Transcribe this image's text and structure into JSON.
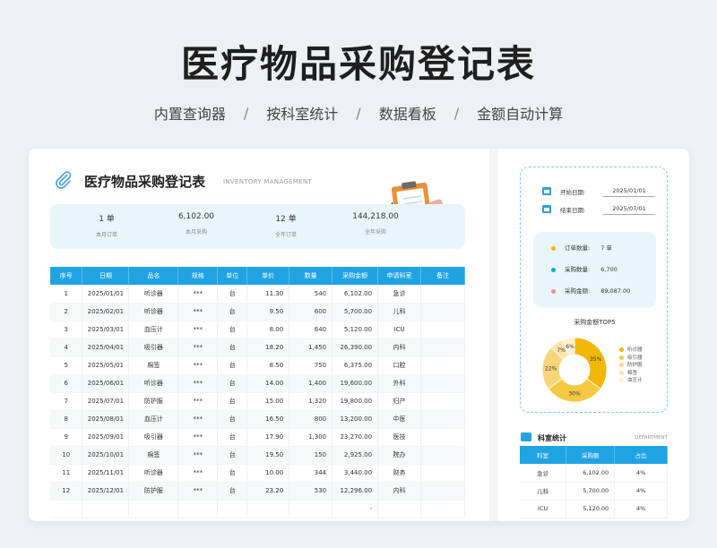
{
  "hero": {
    "title": "医疗物品采购登记表",
    "features": [
      "内置查询器",
      "按科室统计",
      "数据看板",
      "金额自动计算"
    ],
    "separator": "/"
  },
  "sheet": {
    "title": "医疗物品采购登记表",
    "subtitle": "INVENTORY MANAGEMENT"
  },
  "stats": [
    {
      "value": "1 单",
      "label": "本月订单"
    },
    {
      "value": "6,102.00",
      "label": "本月采购"
    },
    {
      "value": "12 单",
      "label": "全年订单"
    },
    {
      "value": "144,218.00",
      "label": "全年采购"
    }
  ],
  "table": {
    "headers": [
      "序号",
      "日期",
      "品名",
      "规格",
      "单位",
      "单价",
      "数量",
      "采购金额",
      "申请科室",
      "备注"
    ],
    "rows": [
      [
        "1",
        "2025/01/01",
        "听诊器",
        "***",
        "台",
        "11.30",
        "540",
        "6,102.00",
        "急诊",
        ""
      ],
      [
        "2",
        "2025/02/01",
        "听诊器",
        "***",
        "台",
        "9.50",
        "600",
        "5,700.00",
        "儿科",
        ""
      ],
      [
        "3",
        "2025/03/01",
        "血压计",
        "***",
        "台",
        "8.00",
        "640",
        "5,120.00",
        "ICU",
        ""
      ],
      [
        "4",
        "2025/04/01",
        "吸引器",
        "***",
        "台",
        "18.20",
        "1,450",
        "26,390.00",
        "内科",
        ""
      ],
      [
        "5",
        "2025/05/01",
        "棉签",
        "***",
        "台",
        "8.50",
        "750",
        "6,375.00",
        "口腔",
        ""
      ],
      [
        "6",
        "2025/06/01",
        "听诊器",
        "***",
        "台",
        "14.00",
        "1,400",
        "19,600.00",
        "外科",
        ""
      ],
      [
        "7",
        "2025/07/01",
        "防护服",
        "***",
        "台",
        "15.00",
        "1,320",
        "19,800.00",
        "妇产",
        ""
      ],
      [
        "8",
        "2025/08/01",
        "血压计",
        "***",
        "台",
        "16.50",
        "800",
        "13,200.00",
        "中医",
        ""
      ],
      [
        "9",
        "2025/09/01",
        "吸引器",
        "***",
        "台",
        "17.90",
        "1,300",
        "23,270.00",
        "医技",
        ""
      ],
      [
        "10",
        "2025/10/01",
        "棉签",
        "***",
        "台",
        "19.50",
        "150",
        "2,925.00",
        "院办",
        ""
      ],
      [
        "11",
        "2025/11/01",
        "听诊器",
        "***",
        "台",
        "10.00",
        "344",
        "3,440.00",
        "财务",
        ""
      ],
      [
        "12",
        "2025/12/01",
        "防护服",
        "***",
        "台",
        "23.20",
        "530",
        "12,296.00",
        "内科",
        ""
      ],
      [
        "",
        "",
        "",
        "",
        "",
        "",
        "",
        "-",
        "",
        ""
      ]
    ]
  },
  "dates": {
    "start_label": "开始日期:",
    "start_value": "2025/01/01",
    "end_label": "结束日期:",
    "end_value": "2025/07/01"
  },
  "summary": [
    {
      "label": "订单数量:",
      "value": "7 单",
      "color": "#f2b705"
    },
    {
      "label": "采购数量:",
      "value": "6,700",
      "color": "#1aa3e0"
    },
    {
      "label": "采购金额:",
      "value": "89,087.00",
      "color": "#f28b8b"
    }
  ],
  "chart_data": {
    "type": "pie",
    "title": "采购金额TOP5",
    "categories": [
      "听诊器",
      "吸引器",
      "防护服",
      "棉签",
      "血压计"
    ],
    "values": [
      35,
      30,
      22,
      7,
      6
    ],
    "labels": [
      "35%",
      "30%",
      "22%",
      "7%",
      "6%"
    ],
    "colors": [
      "#f2b705",
      "#f5c842",
      "#f8d57a",
      "#fbe4a8",
      "#fdf0d0"
    ],
    "legend_position": "right"
  },
  "dept": {
    "title": "科室统计",
    "subtitle": "DEPARTMENT",
    "headers": [
      "科室",
      "采购额",
      "占比"
    ],
    "rows": [
      [
        "急诊",
        "6,102.00",
        "4%"
      ],
      [
        "儿科",
        "5,700.00",
        "4%"
      ],
      [
        "ICU",
        "5,120.00",
        "4%"
      ]
    ]
  }
}
